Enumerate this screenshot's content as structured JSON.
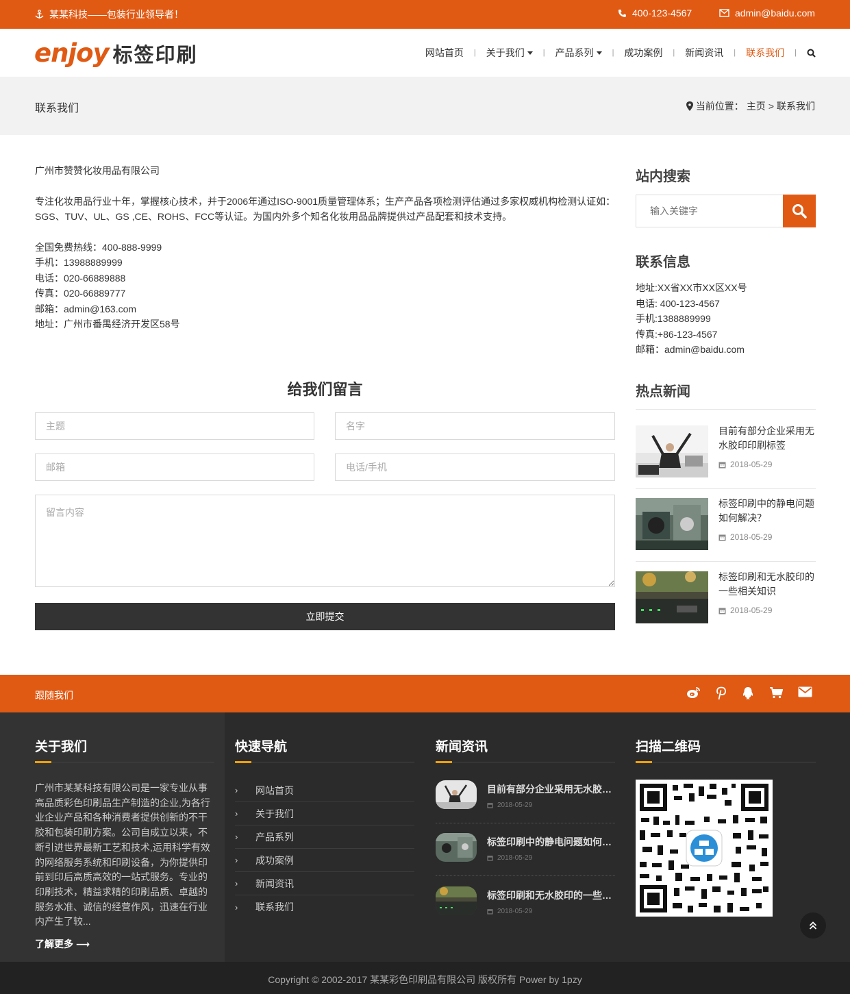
{
  "topbar": {
    "slogan": "某某科技——包装行业领导者！",
    "phone": "400-123-4567",
    "email": "admin@baidu.com"
  },
  "logo": {
    "en": "enjoy",
    "cn": "标签印刷"
  },
  "nav": [
    {
      "label": "网站首页",
      "dropdown": false,
      "active": false
    },
    {
      "label": "关于我们",
      "dropdown": true,
      "active": false
    },
    {
      "label": "产品系列",
      "dropdown": true,
      "active": false
    },
    {
      "label": "成功案例",
      "dropdown": false,
      "active": false
    },
    {
      "label": "新闻资讯",
      "dropdown": false,
      "active": false
    },
    {
      "label": "联系我们",
      "dropdown": false,
      "active": true
    }
  ],
  "pagebar": {
    "title": "联系我们",
    "crumb_prefix": "当前位置：",
    "crumb_home": "主页",
    "crumb_sep": ">",
    "crumb_current": "联系我们"
  },
  "main": {
    "company": "广州市赞赞化妆用品有限公司",
    "intro": "专注化妆用品行业十年，掌握核心技术，并于2006年通过ISO-9001质量管理体系；生产产品各项检测评估通过多家权威机构检测认证如：SGS、TUV、UL、GS ,CE、ROHS、FCC等认证。为国内外多个知名化妆用品品牌提供过产品配套和技术支持。",
    "lines": [
      "全国免费热线：400-888-9999",
      "手机：13988889999",
      "电话：020-66889888",
      "传真：020-66889777",
      "邮箱：admin@163.com",
      "地址：广州市番禺经济开发区58号"
    ]
  },
  "form": {
    "title": "给我们留言",
    "subject": "主题",
    "name": "名字",
    "email": "邮箱",
    "phone": "电话/手机",
    "message": "留言内容",
    "submit": "立即提交"
  },
  "sidebar": {
    "search_title": "站内搜索",
    "search_placeholder": "输入关键字",
    "contact_title": "联系信息",
    "contact": [
      "地址:XX省XX市XX区XX号",
      "电话: 400-123-4567",
      "手机:1388889999",
      "传真:+86-123-4567",
      "邮箱：admin@baidu.com"
    ],
    "news_title": "热点新闻",
    "news": [
      {
        "title": "目前有部分企业采用无水胶印印刷标签",
        "date": "2018-05-29"
      },
      {
        "title": "标签印刷中的静电问题如何解决？",
        "date": "2018-05-29"
      },
      {
        "title": "标签印刷和无水胶印的一些相关知识",
        "date": "2018-05-29"
      }
    ]
  },
  "follow": {
    "label": "跟随我们",
    "icons": [
      "weibo-icon",
      "pinterest-icon",
      "qq-icon",
      "cart-icon",
      "mail-icon"
    ]
  },
  "footer": {
    "about_title": "关于我们",
    "about_text": "广州市某某科技有限公司是一家专业从事高品质彩色印刷品生产制造的企业,为各行业企业产品和各种消费者提供创新的不干胶和包装印刷方案。公司自成立以来，不断引进世界最新工艺和技术,运用科学有效的网络服务系统和印刷设备，为你提供印前到印后高质高效的一站式服务。专业的印刷技术，精益求精的印刷品质、卓越的服务水准、诚信的经营作风，迅速在行业内产生了较...",
    "more": "了解更多",
    "nav_title": "快速导航",
    "nav_items": [
      "网站首页",
      "关于我们",
      "产品系列",
      "成功案例",
      "新闻资讯",
      "联系我们"
    ],
    "news_title": "新闻资讯",
    "news": [
      {
        "title": "目前有部分企业采用无水胶印印刷标签",
        "date": "2018-05-29"
      },
      {
        "title": "标签印刷中的静电问题如何解决？",
        "date": "2018-05-29"
      },
      {
        "title": "标签印刷和无水胶印的一些相关知识",
        "date": "2018-05-29"
      }
    ],
    "qr_title": "扫描二维码"
  },
  "copyright": "Copyright © 2002-2017 某某彩色印刷品有限公司 版权所有 Power by 1pzy",
  "colors": {
    "accent": "#e05a14",
    "dark": "#2b2b2b",
    "underline": "#f0a000"
  }
}
